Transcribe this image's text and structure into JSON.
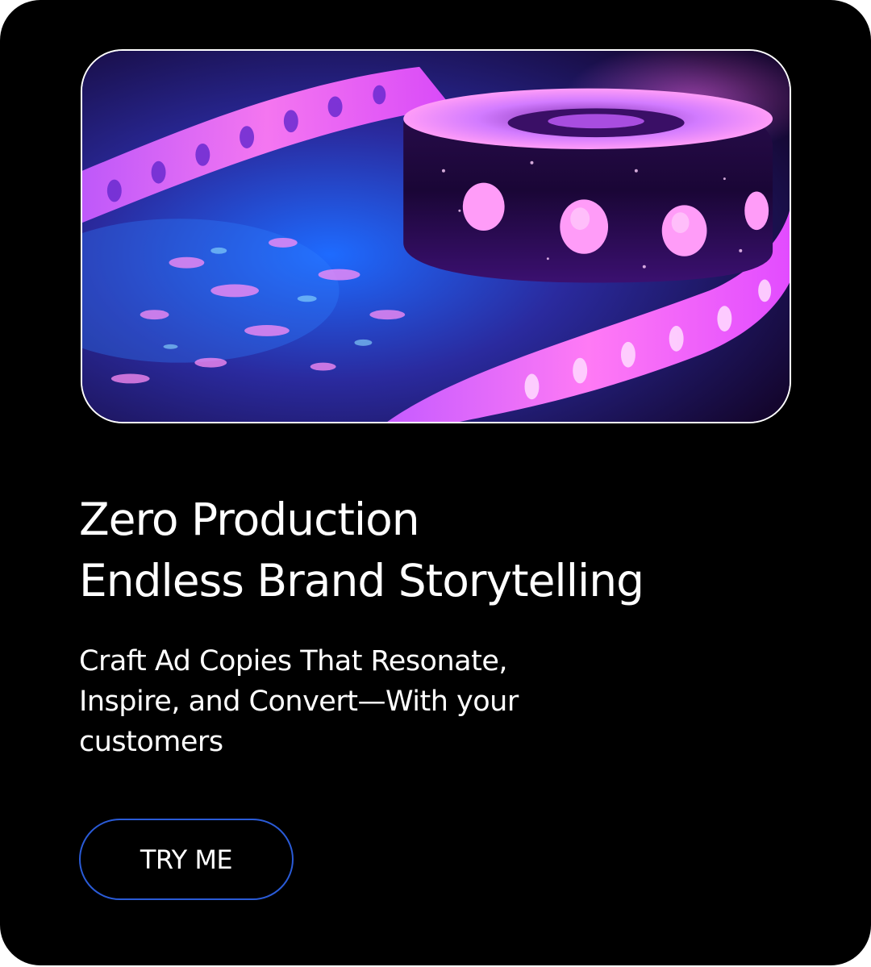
{
  "hero": {
    "image_alt": "Neon pink and blue film reel with perforated film strip on a wet reflective surface"
  },
  "headline": {
    "line1": "Zero Production",
    "line2": "Endless Brand Storytelling"
  },
  "subtext": "Craft Ad Copies That Resonate, Inspire, and Convert—With your customers",
  "cta": {
    "label": "TRY ME"
  },
  "colors": {
    "card_background": "#000000",
    "text": "#ffffff",
    "cta_border": "#2a5bd7",
    "neon_pink": "#ff5cf0",
    "neon_blue": "#2f7dff",
    "deep_purple": "#2a0b5e"
  }
}
